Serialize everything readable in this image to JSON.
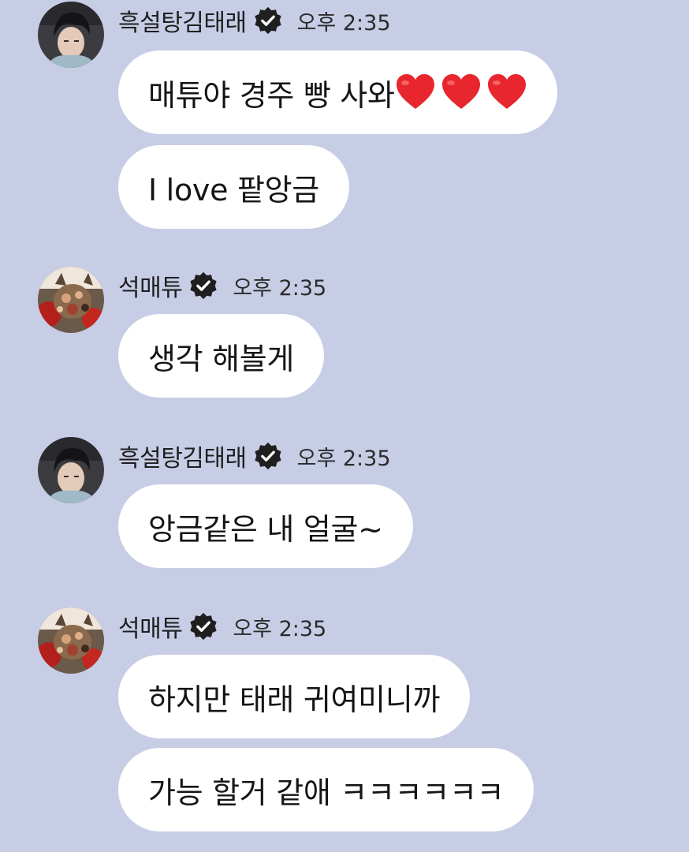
{
  "colors": {
    "background": "#c8cde6",
    "bubble": "#ffffff",
    "verified_badge": "#1f1f1f",
    "heart": "#e8262d"
  },
  "messages": [
    {
      "sender": "흑설탕김태래",
      "avatar_icon": "profile-photo-person",
      "verified_icon": "verified-badge-icon",
      "time": "오후 2:35",
      "bubbles": [
        {
          "text": "매튜야 경주 빵 사와",
          "emoji": [
            "heart",
            "heart",
            "heart"
          ]
        },
        {
          "text": "I love 팥앙금"
        }
      ]
    },
    {
      "sender": "석매튜",
      "avatar_icon": "profile-photo-flowers",
      "verified_icon": "verified-badge-icon",
      "time": "오후 2:35",
      "bubbles": [
        {
          "text": "생각 해볼게"
        }
      ]
    },
    {
      "sender": "흑설탕김태래",
      "avatar_icon": "profile-photo-person",
      "verified_icon": "verified-badge-icon",
      "time": "오후 2:35",
      "bubbles": [
        {
          "text": "앙금같은 내 얼굴~"
        }
      ]
    },
    {
      "sender": "석매튜",
      "avatar_icon": "profile-photo-flowers",
      "verified_icon": "verified-badge-icon",
      "time": "오후 2:35",
      "bubbles": [
        {
          "text": "하지만 태래 귀여미니까"
        },
        {
          "text": "가능 할거 같애 ㅋㅋㅋㅋㅋㅋ"
        }
      ]
    }
  ]
}
